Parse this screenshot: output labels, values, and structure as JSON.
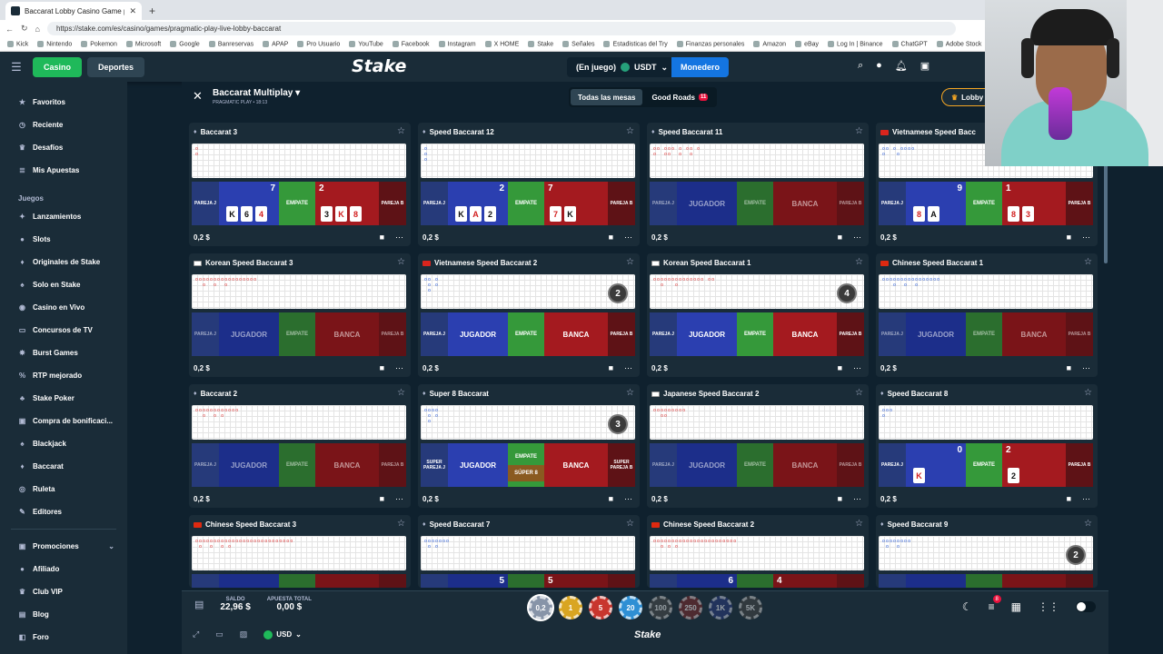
{
  "browser": {
    "tab_title": "Baccarat Lobby Casino Game po",
    "url": "https://stake.com/es/casino/games/pragmatic-play-live-lobby-baccarat",
    "bookmarks": [
      "Kick",
      "Nintendo",
      "Pokemon",
      "Microsoft",
      "Google",
      "Banreservas",
      "APAP",
      "Pro Usuario",
      "YouTube",
      "Facebook",
      "Instagram",
      "X HOME",
      "Stake",
      "Señales",
      "Estadisticas del Try",
      "Finanzas personales",
      "Amazon",
      "eBay",
      "Log In | Binance",
      "ChatGPT",
      "Adobe Stock"
    ]
  },
  "header": {
    "casino": "Casino",
    "deportes": "Deportes",
    "logo": "Stake",
    "balance_mode": "(En juego)",
    "currency": "USDT",
    "wallet_button": "Monedero"
  },
  "sidebar": {
    "top": [
      "Favoritos",
      "Reciente",
      "Desafíos",
      "Mis Apuestas"
    ],
    "section_games": "Juegos",
    "games": [
      "Lanzamientos",
      "Slots",
      "Originales de Stake",
      "Solo en Stake",
      "Casino en Vivo",
      "Concursos de TV",
      "Burst Games",
      "RTP mejorado",
      "Stake Poker",
      "Compra de bonificaci...",
      "Blackjack",
      "Baccarat",
      "Ruleta",
      "Editores"
    ],
    "bottom": [
      "Promociones",
      "Afiliado",
      "Club VIP",
      "Blog",
      "Foro"
    ]
  },
  "lobby": {
    "title": "Baccarat Multiplay",
    "subtitle": "PRAGMATIC PLAY • 18:13",
    "tab_all": "Todas las mesas",
    "tab_good": "Good Roads",
    "good_count": "11",
    "lobby_button": "Lobby"
  },
  "labels": {
    "pareja_j": "PAREJA J",
    "jugador": "JUGADOR",
    "empate": "EMPATE",
    "banca": "BANCA",
    "pareja_b": "PAREJA B",
    "super_pareja_j": "SUPER PAREJA J",
    "super_pareja_b": "SUPER PAREJA B",
    "super8": "SÚPER 8",
    "min_bet": "0,2 $"
  },
  "tables": [
    {
      "name": "Baccarat 3",
      "p": "7",
      "b": "2"
    },
    {
      "name": "Speed Baccarat 12",
      "p": "2",
      "b": "7"
    },
    {
      "name": "Speed Baccarat 11"
    },
    {
      "name": "Vietnamese Speed Bacc",
      "p": "9",
      "b": "1"
    },
    {
      "name": "Korean Speed Baccarat 3"
    },
    {
      "name": "Vietnamese Speed Baccarat 2",
      "badge": "2"
    },
    {
      "name": "Korean Speed Baccarat 1",
      "badge": "4"
    },
    {
      "name": "Chinese Speed Baccarat 1"
    },
    {
      "name": "Baccarat 2"
    },
    {
      "name": "Super 8 Baccarat",
      "badge": "3"
    },
    {
      "name": "Japanese Speed Baccarat 2"
    },
    {
      "name": "Speed Baccarat 8",
      "p": "0",
      "b": "2"
    },
    {
      "name": "Chinese Speed Baccarat 3"
    },
    {
      "name": "Speed Baccarat 7",
      "p": "5",
      "b": "5"
    },
    {
      "name": "Chinese Speed Baccarat 2",
      "p": "6",
      "b": "4"
    },
    {
      "name": "Speed Baccarat 9",
      "badge": "2"
    }
  ],
  "cards": {
    "t0p": [
      "K",
      "6",
      "4"
    ],
    "t0b": [
      "3",
      "K",
      "8"
    ],
    "t1p": [
      "K",
      "A",
      "2"
    ],
    "t1b": [
      "7",
      "K"
    ],
    "t3p": [
      "8",
      "A"
    ],
    "t3b": [
      "8",
      "3"
    ],
    "t11p": [
      "K"
    ],
    "t11b": [
      "2"
    ]
  },
  "footer": {
    "saldo_label": "SALDO",
    "saldo": "22,96 $",
    "total_label": "APUESTA TOTAL",
    "total": "0,00 $",
    "chips": [
      "0,2",
      "1",
      "5",
      "20",
      "100",
      "250",
      "1K",
      "5K"
    ],
    "currency": "USD",
    "logo": "Stake",
    "notification_count": "8"
  }
}
